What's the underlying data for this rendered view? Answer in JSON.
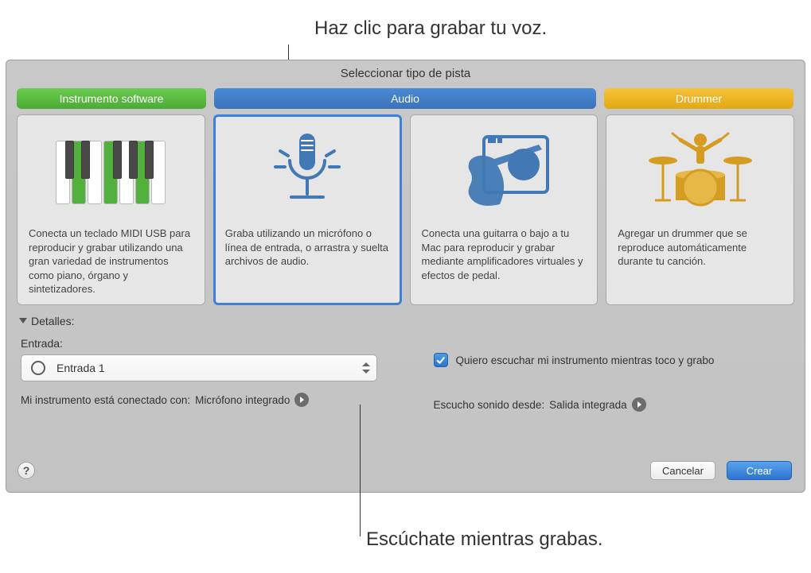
{
  "callouts": {
    "top": "Haz clic para grabar tu voz.",
    "bottom": "Escúchate mientras grabas."
  },
  "window_title": "Seleccionar tipo de pista",
  "tabs": {
    "software": "Instrumento software",
    "audio": "Audio",
    "drummer": "Drummer"
  },
  "cards": {
    "software_desc": "Conecta un teclado MIDI USB para reproducir y grabar utilizando una gran variedad de instrumentos como piano, órgano y sintetizadores.",
    "mic_desc": "Graba utilizando un micrófono o línea de entrada, o arrastra y suelta archivos de audio.",
    "guitar_desc": "Conecta una guitarra o bajo a tu Mac para reproducir y grabar mediante amplificadores virtuales y efectos de pedal.",
    "drummer_desc": "Agregar un drummer que se reproduce automáticamente durante tu canción."
  },
  "details": {
    "label": "Detalles:"
  },
  "input": {
    "label": "Entrada:",
    "selected": "Entrada 1",
    "connected_prefix": "Mi instrumento está conectado con: ",
    "connected_value": "Micrófono integrado"
  },
  "monitoring": {
    "checkbox_label": "Quiero escuchar mi instrumento mientras toco y grabo",
    "output_prefix": "Escucho sonido desde: ",
    "output_value": "Salida integrada"
  },
  "buttons": {
    "help": "?",
    "cancel": "Cancelar",
    "create": "Crear"
  },
  "colors": {
    "green": "#4aab34",
    "blue": "#3b73ba",
    "yellow": "#e3a913",
    "selection": "#3d7fe1"
  }
}
